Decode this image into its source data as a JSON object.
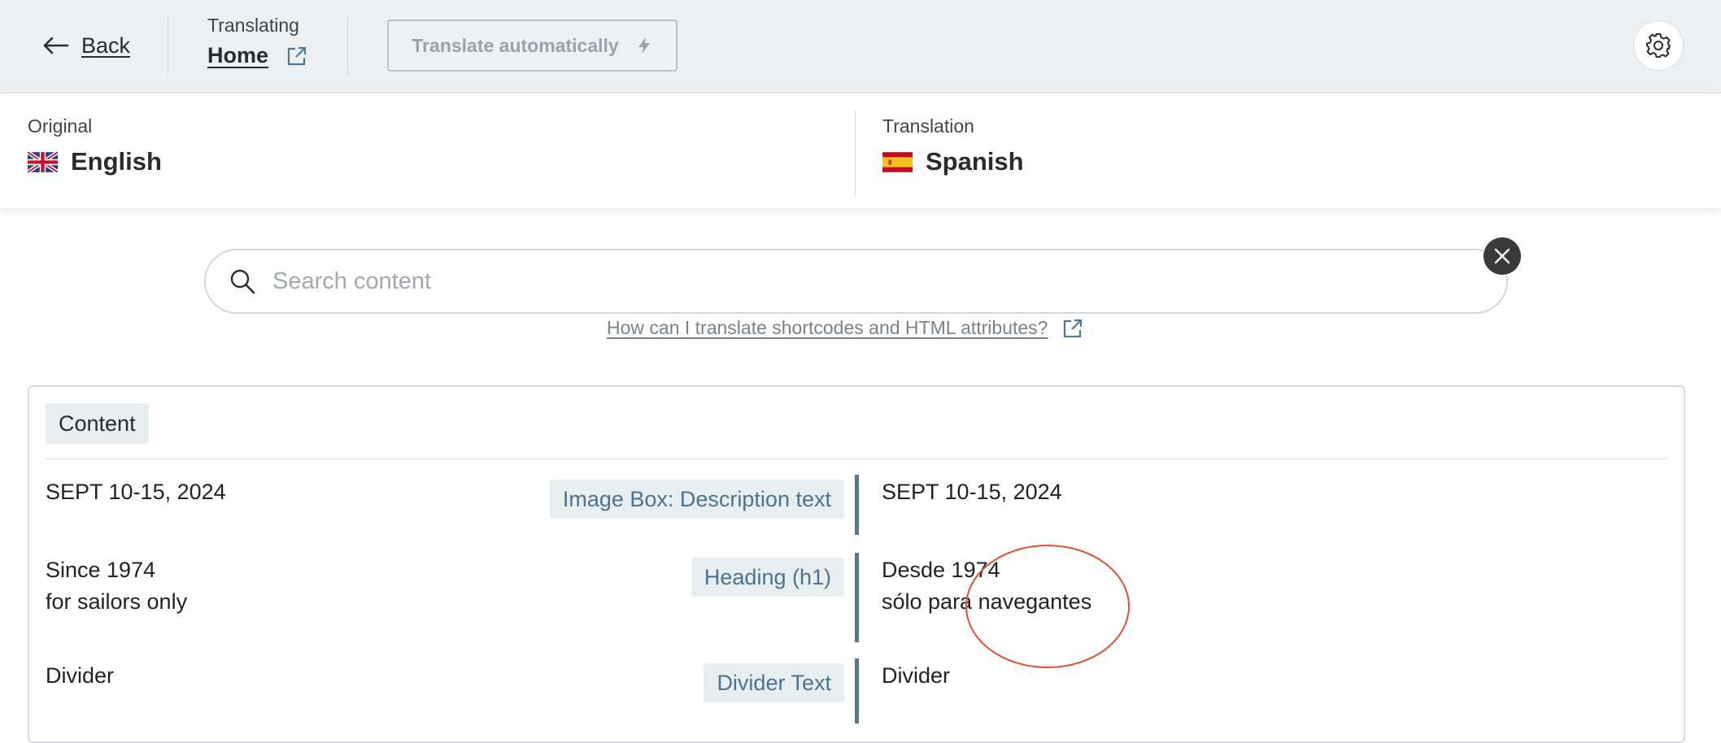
{
  "header": {
    "back_label": "Back",
    "translating_caption": "Translating",
    "page_name": "Home",
    "auto_translate_label": "Translate automatically"
  },
  "languages": {
    "original_caption": "Original",
    "original_language": "English",
    "translation_caption": "Translation",
    "translation_language": "Spanish"
  },
  "search": {
    "placeholder": "Search content",
    "value": ""
  },
  "help_link": "How can I translate shortcodes and HTML attributes?",
  "content": {
    "section_label": "Content",
    "rows": [
      {
        "original": "SEPT 10-15, 2024",
        "tag": "Image Box: Description text",
        "translation": "SEPT 10-15, 2024"
      },
      {
        "original_lines": [
          "Since 1974",
          "for sailors only"
        ],
        "tag": "Heading (h1)",
        "translation_lines": [
          "Desde 1974",
          "sólo para navegantes"
        ]
      },
      {
        "original": "Divider",
        "tag": "Divider Text",
        "translation": "Divider"
      }
    ]
  },
  "colors": {
    "topbar_bg": "#ecf0f3",
    "accent_bar": "#4e7a96",
    "tag_text": "#4a7490",
    "annotation": "#e0502e"
  },
  "icons": {
    "back": "arrow-left-icon",
    "external": "external-link-icon",
    "bolt": "lightning-icon",
    "settings": "gear-icon",
    "search": "search-icon",
    "clear": "close-icon",
    "flag_original": "uk-flag-icon",
    "flag_translation": "spain-flag-icon"
  }
}
